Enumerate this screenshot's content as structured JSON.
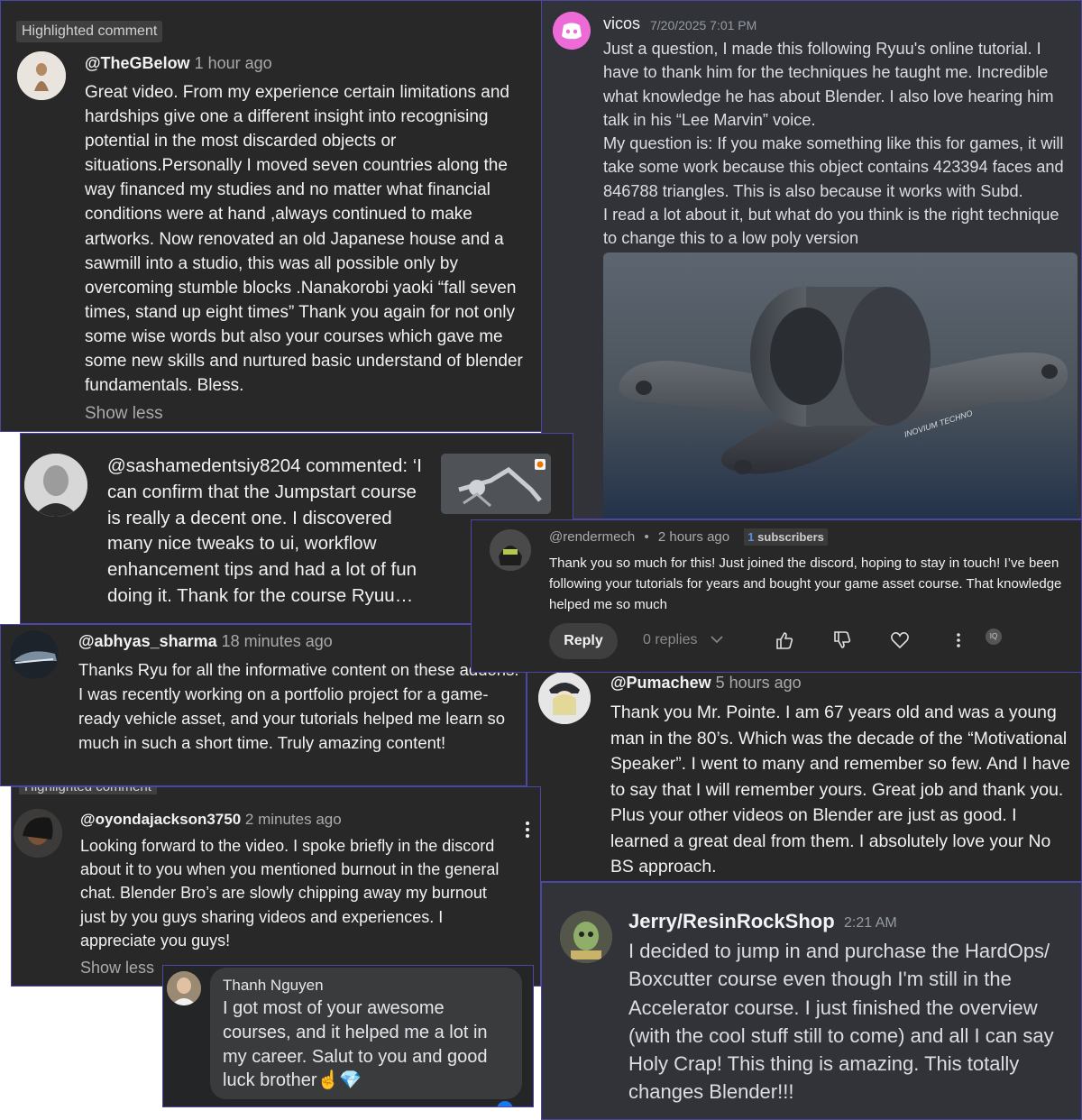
{
  "cards": {
    "gbelow": {
      "badge": "Highlighted comment",
      "handle": "@TheGBelow",
      "time": "1 hour ago",
      "text": "Great video. From my experience certain limitations and hardships give one a different insight into recognising potential in the most discarded objects or situations.Personally I moved seven countries along the way financed my studies and no matter what financial conditions were at hand ,always continued to make artworks. Now renovated an old Japanese house and a sawmill into a studio, this was all possible only by overcoming stumble blocks .Nanakorobi yaoki “fall seven times, stand up eight times” Thank you again for not only some wise words but also  your courses which gave me some new skills and nurtured basic understand of blender fundamentals. Bless.",
      "show_less": "Show less"
    },
    "vicos": {
      "name": "vicos",
      "time": "7/20/2025 7:01 PM",
      "text": "Just a question, I made this following Ryuu's online tutorial. I have to thank him for the techniques he taught me. Incredible what knowledge he has about Blender. I also love hearing him talk in his “Lee Marvin” voice.\nMy question is: If you make something like this for games, it will take some work because this object contains 423394 faces and 846788 triangles. This is also because it works with Subd.\nI read a lot about it, but what do you think is the right technique to change this to a low poly version",
      "image_label": "INOVIUM TECHNO"
    },
    "sasha": {
      "text": "@sashamedentsiy8204 commented: ‘I can confirm that the Jumpstart course is really a decent one. I discovered many nice tweaks to ui, workflow enhancement tips and had a lot of fun doing it. Thank for the course Ryuu…"
    },
    "rendermech": {
      "handle": "@rendermech",
      "sep": "•",
      "time": "2 hours ago",
      "sub_count": "1",
      "sub_label": "subscribers",
      "text": "Thank you so much for this! Just joined the discord, hoping to stay in touch! I’ve been following your tutorials for years and bought your game asset course. That knowledge helped me so much",
      "reply_label": "Reply",
      "replies": "0 replies",
      "tag": "IQ"
    },
    "abhyas": {
      "handle": "@abhyas_sharma",
      "time": "18 minutes ago",
      "text": "Thanks Ryu for all the informative content on these addons! I was recently working on a portfolio project for a game-ready vehicle asset, and your tutorials helped me learn so much in such a short time. Truly amazing content!"
    },
    "pumachew": {
      "handle": "@Pumachew",
      "time": "5 hours ago",
      "text": "Thank you Mr. Pointe. I am 67 years old and was a young man in the 80’s. Which was the decade of the “Motivational Speaker”. I went to many and remember so few. And I have to say that I will remember yours. Great job and thank you. Plus your other videos on Blender are just as good. I learned a great deal from them. I absolutely love your No BS approach."
    },
    "oyonda": {
      "cut_badge": "Highlighted comment",
      "handle": "@oyondajackson3750",
      "time": "2 minutes ago",
      "text": "Looking forward to the video. I spoke briefly in the discord about it to you when you mentioned burnout in the general chat. Blender Bro’s are slowly chipping away my burnout just by you guys sharing videos and experiences. I appreciate you guys!",
      "show_less": "Show less"
    },
    "jerry": {
      "name": "Jerry/ResinRockShop",
      "time": "2:21 AM",
      "text": "I decided to jump in and purchase the HardOps/ Boxcutter course even though I'm still in the Accelerator course.  I just finished the overview (with the cool stuff still to come) and all I can say Holy Crap!  This thing is amazing.  This totally changes Blender!!!"
    },
    "thanh": {
      "name": "Thanh Nguyen",
      "text": "I got most of your awesome courses, and it helped me a lot in my career. Salut to you and good luck brother☝️💎"
    }
  },
  "colors": {
    "youtube_bg": "#282828",
    "discord_bg": "#313338",
    "facebook_bg": "#242526",
    "frame_border": "#4b47a6",
    "discord_brand": "#f47fff"
  },
  "icons": [
    "discord-logo-icon",
    "thumbs-up-icon",
    "thumbs-down-icon",
    "heart-icon",
    "more-vert-icon",
    "chevron-down-icon",
    "blender-logo-icon"
  ]
}
